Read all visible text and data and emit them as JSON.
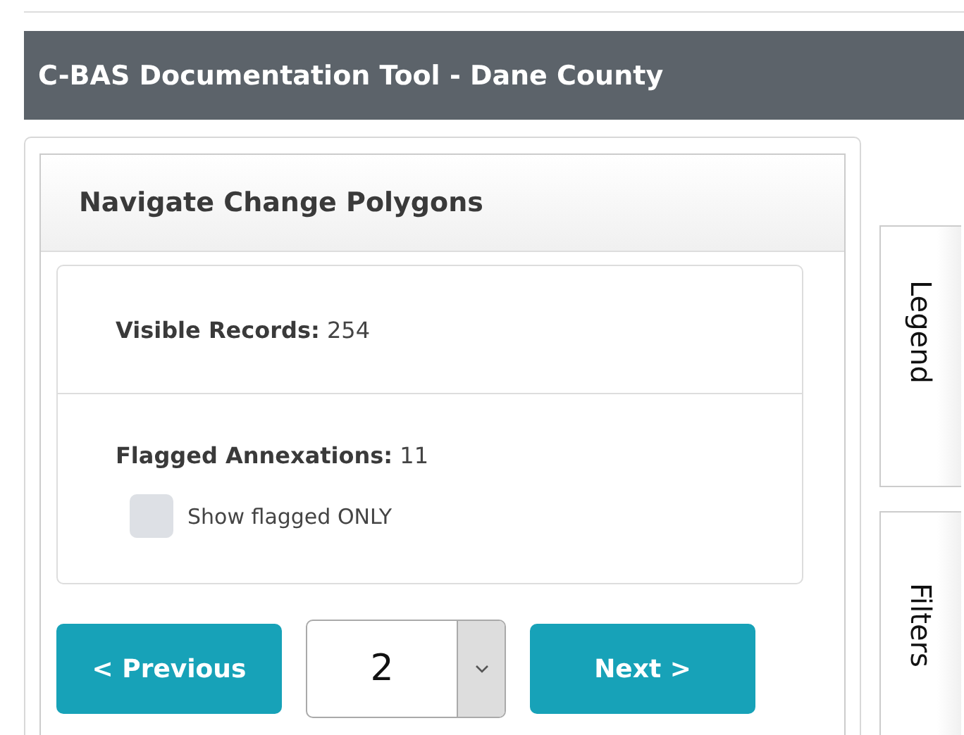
{
  "header": {
    "title": "C-BAS Documentation Tool - Dane County"
  },
  "panel": {
    "title": "Navigate Change Polygons",
    "stats": [
      {
        "label": "Visible Records:",
        "value": "254"
      },
      {
        "label": "Flagged Annexations:",
        "value": "11"
      }
    ],
    "checkbox": {
      "label": "Show flagged ONLY",
      "checked": false
    },
    "pager": {
      "previous": "< Previous",
      "page": "2",
      "next": "Next >"
    }
  },
  "side_tabs": [
    {
      "label": "Legend"
    },
    {
      "label": "Filters"
    }
  ]
}
